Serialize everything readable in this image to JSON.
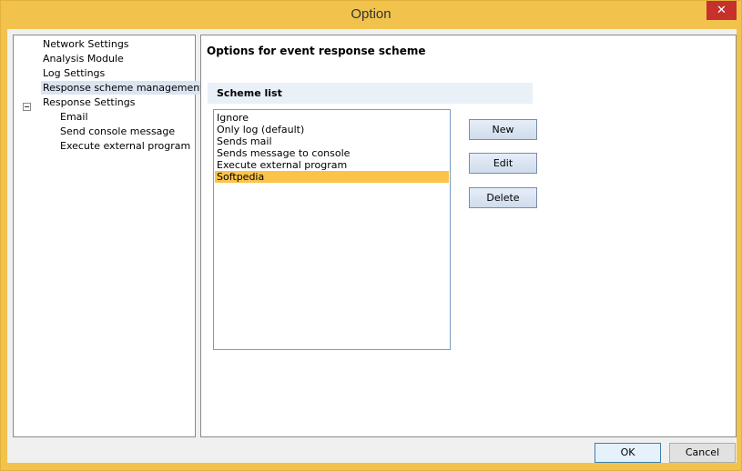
{
  "window": {
    "title": "Option",
    "close_glyph": "✕"
  },
  "tree": {
    "items": [
      {
        "label": "Network Settings",
        "level": 1,
        "selected": false
      },
      {
        "label": "Analysis Module",
        "level": 1,
        "selected": false
      },
      {
        "label": "Log Settings",
        "level": 1,
        "selected": false
      },
      {
        "label": "Response scheme management",
        "level": 1,
        "selected": true
      },
      {
        "label": "Response Settings",
        "level": 1,
        "selected": false,
        "expanded": true
      },
      {
        "label": "Email",
        "level": 2,
        "selected": false
      },
      {
        "label": "Send console message",
        "level": 2,
        "selected": false
      },
      {
        "label": "Execute external program",
        "level": 2,
        "selected": false
      }
    ]
  },
  "panel": {
    "heading": "Options for event response scheme",
    "group_title": "Scheme list",
    "schemes": [
      {
        "label": "Ignore",
        "selected": false
      },
      {
        "label": "Only log (default)",
        "selected": false
      },
      {
        "label": "Sends mail",
        "selected": false
      },
      {
        "label": "Sends message to console",
        "selected": false
      },
      {
        "label": "Execute external program",
        "selected": false
      },
      {
        "label": "Softpedia",
        "selected": true
      }
    ],
    "new_label": "New",
    "edit_label": "Edit",
    "delete_label": "Delete"
  },
  "footer": {
    "ok_label": "OK",
    "cancel_label": "Cancel"
  },
  "colors": {
    "frame": "#f1c34d",
    "close": "#c7302b",
    "tree_selection": "#dbe5f1",
    "list_selection": "#fbc34a"
  }
}
